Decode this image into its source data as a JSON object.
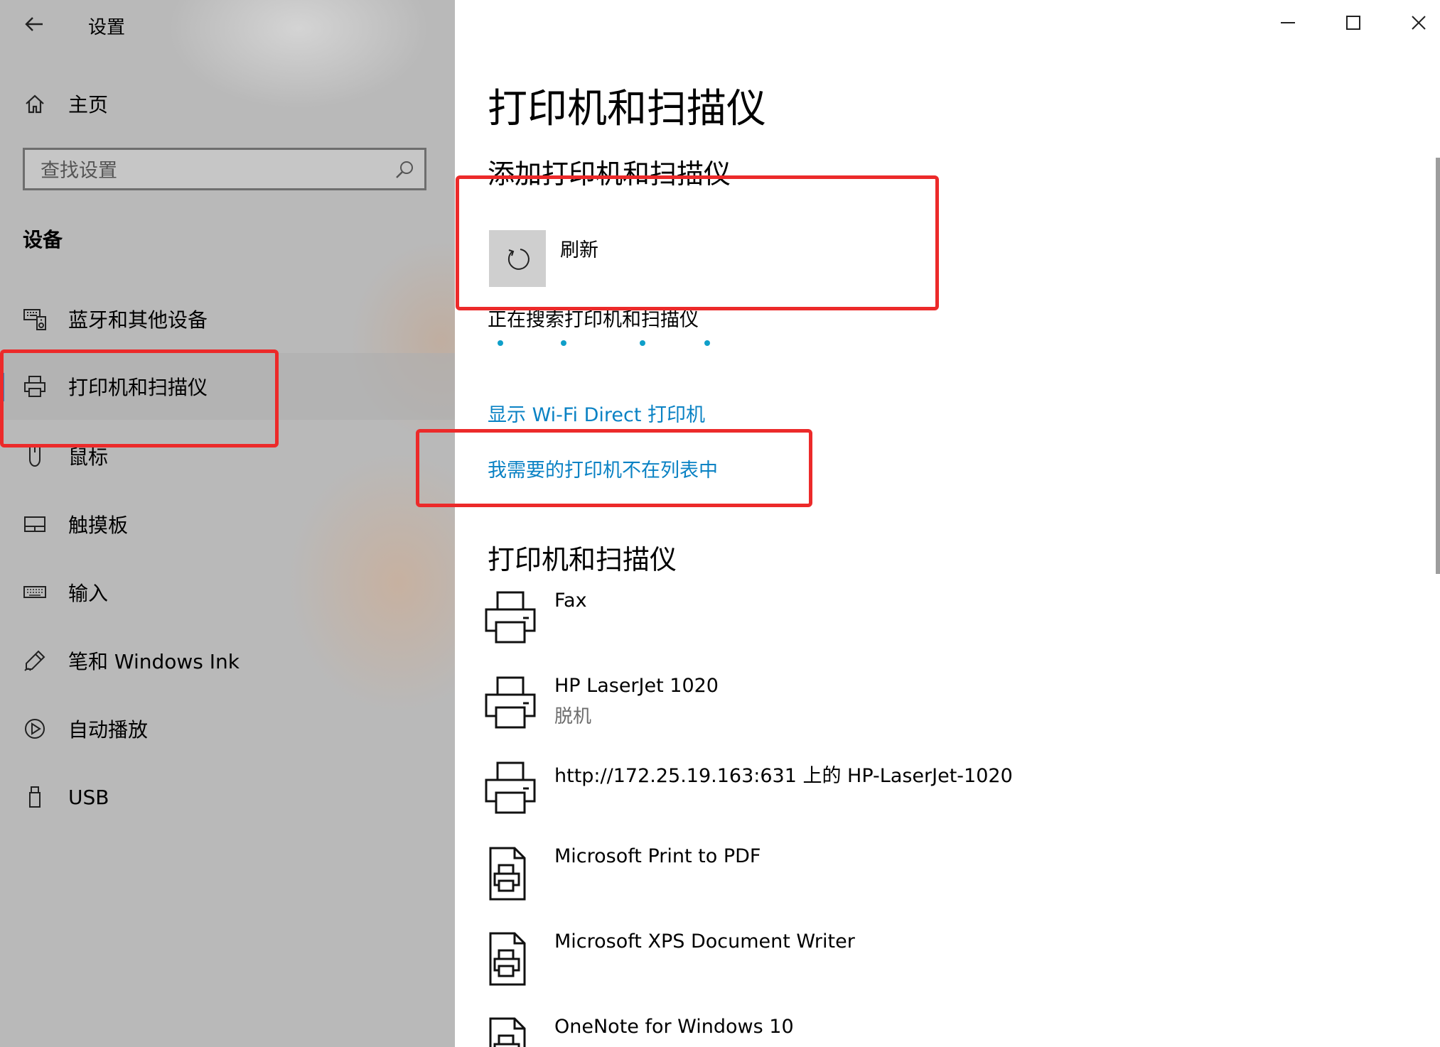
{
  "window": {
    "title": "设置"
  },
  "sidebar": {
    "home_label": "主页",
    "search_placeholder": "查找设置",
    "section_title": "设备",
    "items": [
      {
        "label": "蓝牙和其他设备",
        "icon": "keyboard-speaker-icon"
      },
      {
        "label": "打印机和扫描仪",
        "icon": "printer-icon",
        "selected": true
      },
      {
        "label": "鼠标",
        "icon": "mouse-icon"
      },
      {
        "label": "触摸板",
        "icon": "touchpad-icon"
      },
      {
        "label": "输入",
        "icon": "keyboard-icon"
      },
      {
        "label": "笔和 Windows Ink",
        "icon": "pen-icon"
      },
      {
        "label": "自动播放",
        "icon": "autoplay-icon"
      },
      {
        "label": "USB",
        "icon": "usb-icon"
      }
    ]
  },
  "main": {
    "title": "打印机和扫描仪",
    "add_section_title": "添加打印机和扫描仪",
    "refresh_label": "刷新",
    "searching_text": "正在搜索打印机和扫描仪",
    "link_wifi_direct": "显示 Wi-Fi Direct 打印机",
    "link_not_listed": "我需要的打印机不在列表中",
    "printers_section_title": "打印机和扫描仪",
    "printers": [
      {
        "name": "Fax",
        "status": "",
        "icon": "printer-icon"
      },
      {
        "name": "HP LaserJet 1020",
        "status": "脱机",
        "icon": "printer-icon"
      },
      {
        "name": "http://172.25.19.163:631 上的 HP-LaserJet-1020",
        "status": "",
        "icon": "printer-icon"
      },
      {
        "name": "Microsoft Print to PDF",
        "status": "",
        "icon": "document-printer-icon"
      },
      {
        "name": "Microsoft XPS Document Writer",
        "status": "",
        "icon": "document-printer-icon"
      },
      {
        "name": "OneNote for Windows 10",
        "status": "",
        "icon": "document-printer-icon"
      }
    ]
  },
  "colors": {
    "accent": "#1a8fcf",
    "link": "#0a82c4",
    "highlight": "#ec2a2a",
    "progress_dot": "#0f9fc9"
  }
}
